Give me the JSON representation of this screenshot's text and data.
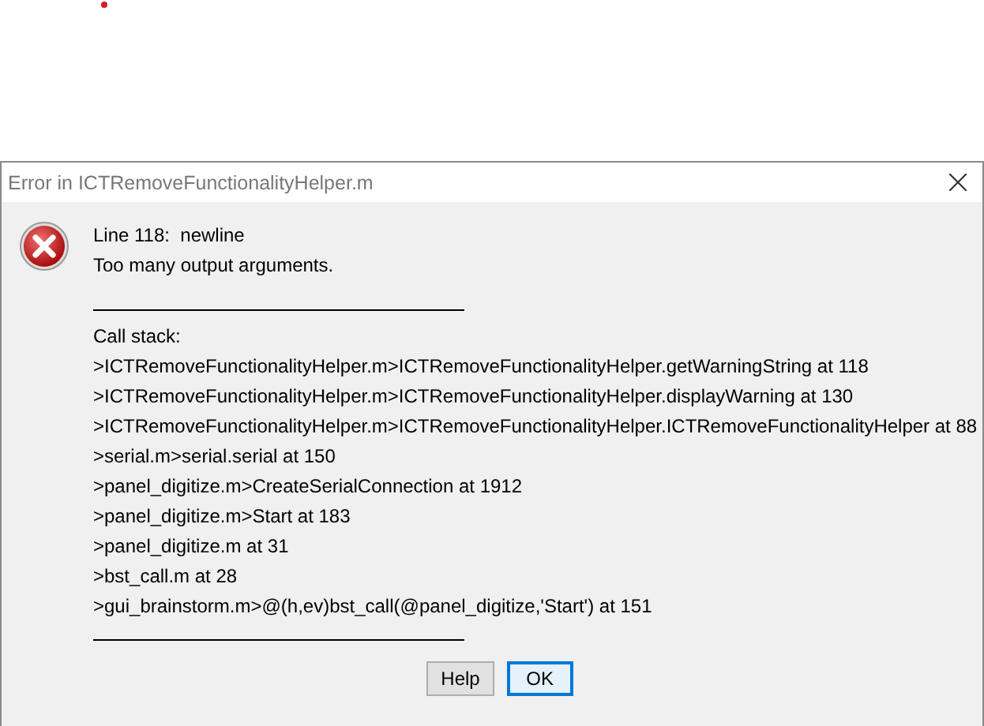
{
  "window": {
    "title": "Error in ICTRemoveFunctionalityHelper.m"
  },
  "message": [
    "Line 118:  newline",
    "Too many output arguments."
  ],
  "call_stack_heading": "Call stack:",
  "call_stack": [
    ">ICTRemoveFunctionalityHelper.m>ICTRemoveFunctionalityHelper.getWarningString at 118",
    ">ICTRemoveFunctionalityHelper.m>ICTRemoveFunctionalityHelper.displayWarning at 130",
    ">ICTRemoveFunctionalityHelper.m>ICTRemoveFunctionalityHelper.ICTRemoveFunctionalityHelper at 88",
    ">serial.m>serial.serial at 150",
    ">panel_digitize.m>CreateSerialConnection at 1912",
    ">panel_digitize.m>Start at 183",
    ">panel_digitize.m at 31",
    ">bst_call.m at 28",
    ">gui_brainstorm.m>@(h,ev)bst_call(@panel_digitize,'Start') at 151"
  ],
  "buttons": [
    {
      "label": "Help",
      "default": false
    },
    {
      "label": "OK",
      "default": true
    }
  ]
}
